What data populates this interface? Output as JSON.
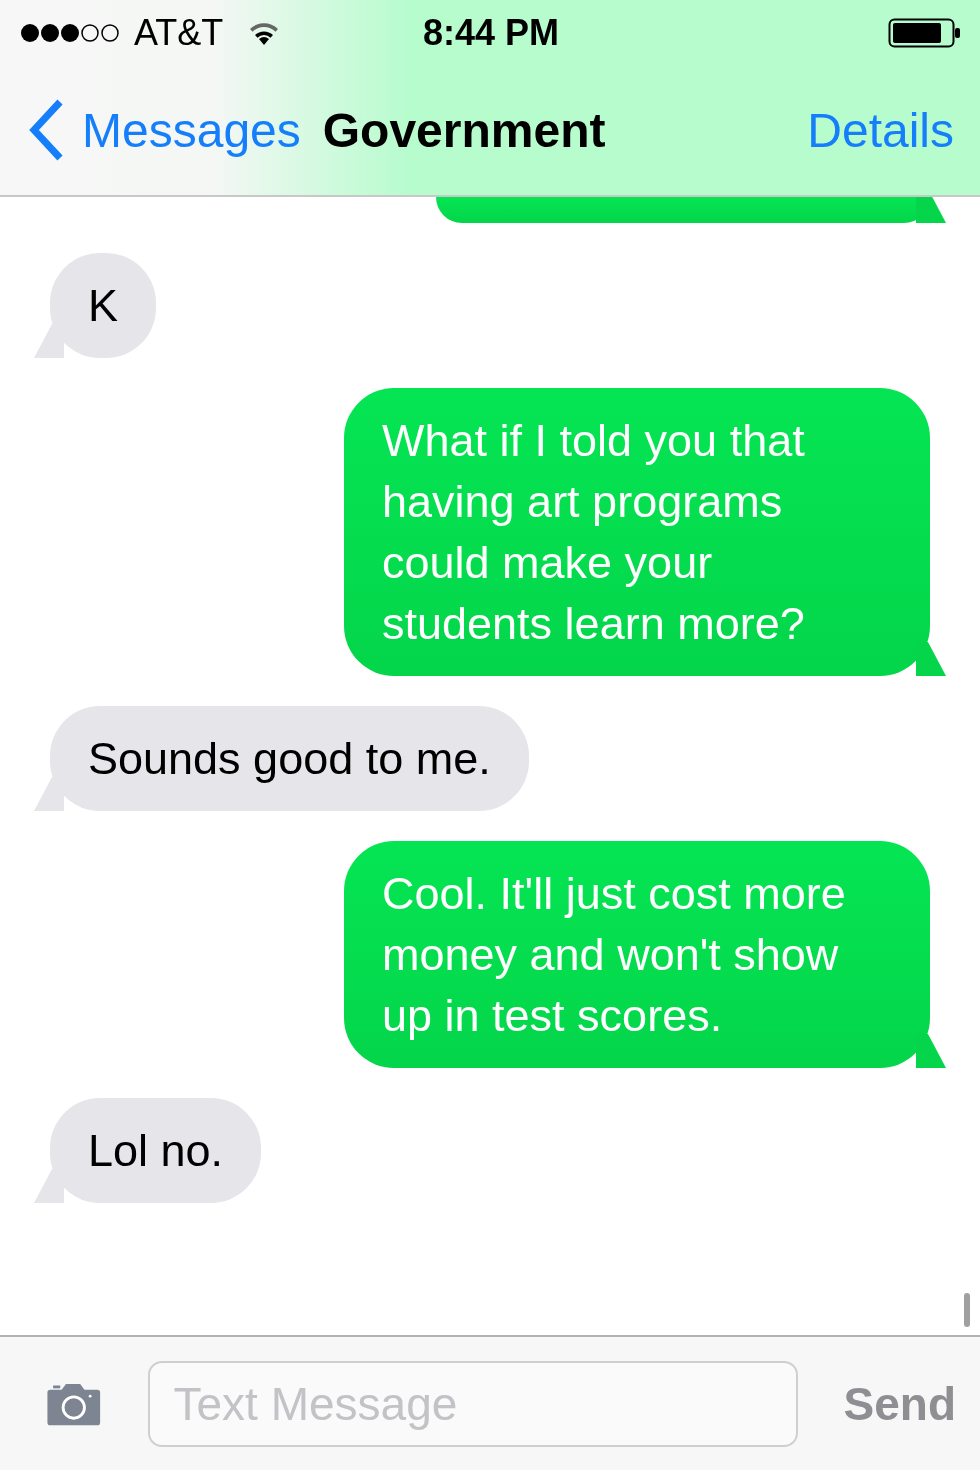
{
  "status_bar": {
    "carrier": "AT&T",
    "time": "8:44 PM"
  },
  "nav": {
    "back": "Messages",
    "title": "Government",
    "action": "Details"
  },
  "messages": [
    {
      "kind": "sent",
      "cut": true
    },
    {
      "kind": "received",
      "text": "K"
    },
    {
      "kind": "sent",
      "text": "What if I told you that having art programs could make your students learn more?"
    },
    {
      "kind": "received",
      "text": "Sounds good to me."
    },
    {
      "kind": "sent",
      "text": "Cool. It'll just cost more money and won't show up in test scores."
    },
    {
      "kind": "received",
      "text": "Lol no."
    }
  ],
  "composer": {
    "placeholder": "Text Message",
    "send": "Send"
  }
}
